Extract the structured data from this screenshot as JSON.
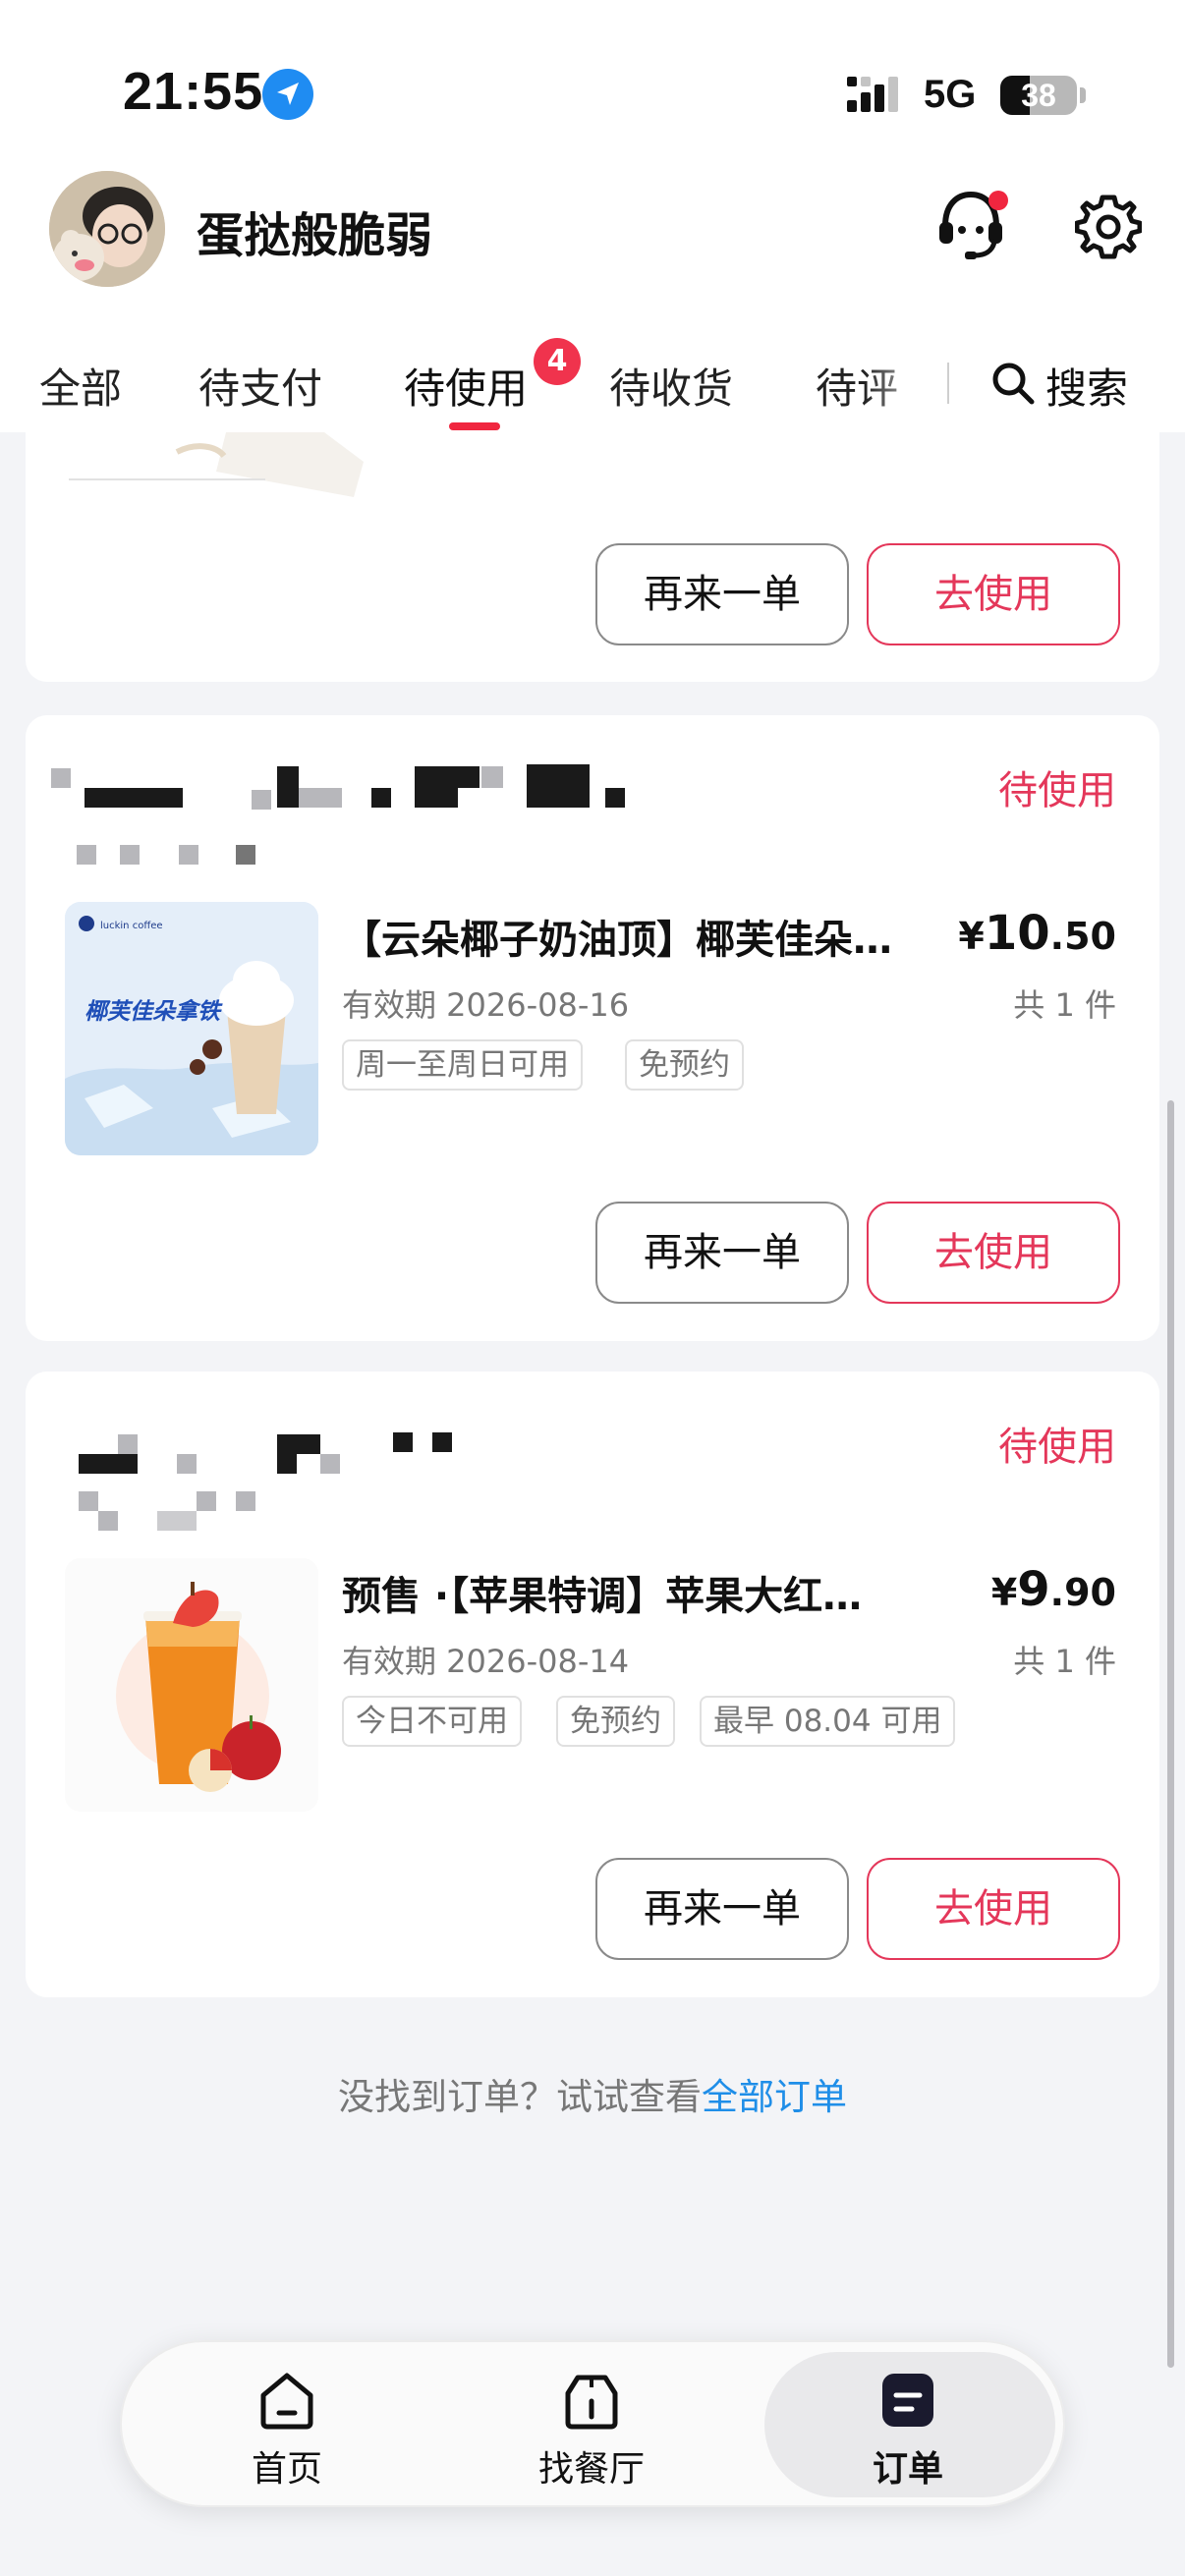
{
  "status_bar": {
    "time": "21:55",
    "network": "5G",
    "battery_level": "38",
    "battery_fraction": 0.38
  },
  "profile": {
    "username": "蛋挞般脆弱",
    "customer_service_icon": "headset-icon",
    "settings_icon": "gear-icon",
    "notification_dot_color": "#f0263f"
  },
  "tabs": {
    "items": [
      {
        "label": "全部"
      },
      {
        "label": "待支付"
      },
      {
        "label": "待使用"
      },
      {
        "label": "待收货"
      },
      {
        "label": "待评"
      }
    ],
    "active_index": 2,
    "badge": "4",
    "search_label": "搜索"
  },
  "orders": [
    {
      "again_label": "再来一单",
      "use_label": "去使用"
    },
    {
      "status": "待使用",
      "title": "【云朵椰子奶油顶】椰芙佳朵…",
      "expire": "有效期 2026-08-16",
      "price_currency": "¥",
      "price_int": "10",
      "price_dec": ".50",
      "quantity": "共 1 件",
      "tags": [
        "周一至周日可用",
        "免预约"
      ],
      "thumb_text": "椰芙佳朵拿铁",
      "again_label": "再来一单",
      "use_label": "去使用"
    },
    {
      "status": "待使用",
      "title": "预售 ·【苹果特调】苹果大红…",
      "expire": "有效期 2026-08-14",
      "price_currency": "¥",
      "price_int": "9",
      "price_dec": ".90",
      "quantity": "共 1 件",
      "tags": [
        "今日不可用",
        "免预约",
        "最早 08.04 可用"
      ],
      "again_label": "再来一单",
      "use_label": "去使用"
    }
  ],
  "footer": {
    "hint": "没找到订单？试试查看",
    "link": "全部订单"
  },
  "bottom_nav": {
    "items": [
      {
        "label": "首页",
        "icon": "home-icon"
      },
      {
        "label": "找餐厅",
        "icon": "store-icon"
      },
      {
        "label": "订单",
        "icon": "orders-icon"
      }
    ],
    "active_index": 2
  },
  "colors": {
    "accent": "#e4375a",
    "badge": "#f0334d",
    "link": "#1f8ee8",
    "background": "#f3f4f7"
  }
}
